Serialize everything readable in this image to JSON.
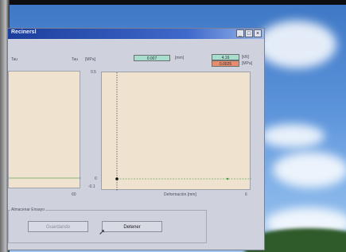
{
  "window": {
    "title": "Recinersl",
    "controls": [
      "_",
      "□",
      "×"
    ]
  },
  "header": {
    "tau_left": "Tau",
    "tau_right": "Tau",
    "unit_mpa": "[MPa]",
    "readout_mm": "0.007",
    "unit_mm": "[mm]",
    "readout_kn": "4.16",
    "unit_kn": "[kN]",
    "readout_mpa": "0.0025",
    "unit_mpa_2": "[MPa]"
  },
  "plot": {
    "y_top_label": "0.5",
    "y_zero_label": "0",
    "y_bottom_label": "-0.1",
    "left_x_label": "60",
    "x_axis_label": "Deformación [mm]",
    "x_end_label": "6"
  },
  "group": {
    "title": "Almacenar Ensayo",
    "save_label": "Guardando",
    "stop_label": "Detener"
  },
  "colors": {
    "readout_mm_bg": "#a8dccd",
    "readout_kn_bg": "#a8dccd",
    "readout_mpa_bg": "#e88c6d"
  }
}
